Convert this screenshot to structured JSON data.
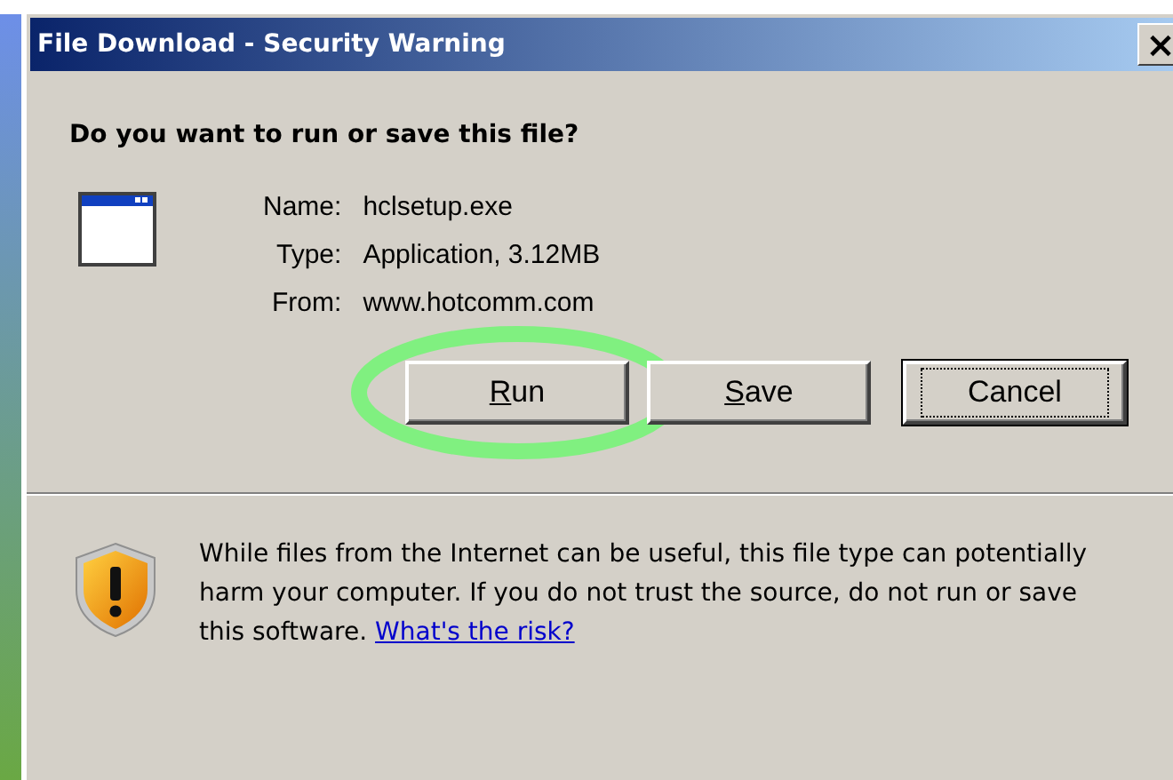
{
  "window": {
    "title": "File Download - Security Warning",
    "close_label": "×"
  },
  "question": "Do you want to run or save this file?",
  "fields": [
    {
      "label": "Name:",
      "value": "hclsetup.exe"
    },
    {
      "label": "Type:",
      "value": "Application, 3.12MB"
    },
    {
      "label": "From:",
      "value": "www.hotcomm.com"
    }
  ],
  "buttons": [
    {
      "label": "Run",
      "access_key": true,
      "focused": false,
      "highlighted": true
    },
    {
      "label": "Save",
      "access_key": true,
      "focused": false,
      "highlighted": false
    },
    {
      "label": "Cancel",
      "focused": true,
      "highlighted": false
    }
  ],
  "warning": {
    "text": "While files from the Internet can be useful, this file type can potentially harm your computer. If you do not trust the source, do not run or save this software.",
    "link": "What's the risk?"
  }
}
